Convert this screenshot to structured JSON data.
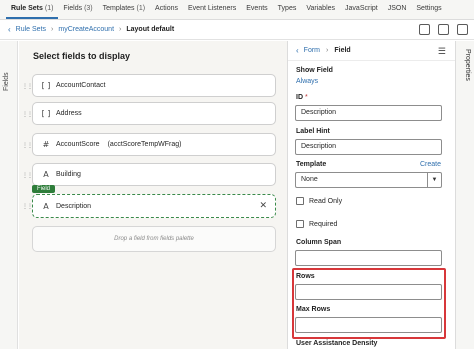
{
  "tabs": [
    {
      "label": "Rule Sets",
      "count": "(1)",
      "active": true
    },
    {
      "label": "Fields",
      "count": "(3)",
      "active": false
    },
    {
      "label": "Templates",
      "count": "(1)",
      "active": false
    },
    {
      "label": "Actions",
      "count": "",
      "active": false
    },
    {
      "label": "Event Listeners",
      "count": "",
      "active": false
    },
    {
      "label": "Events",
      "count": "",
      "active": false
    },
    {
      "label": "Types",
      "count": "",
      "active": false
    },
    {
      "label": "Variables",
      "count": "",
      "active": false
    },
    {
      "label": "JavaScript",
      "count": "",
      "active": false
    },
    {
      "label": "JSON",
      "count": "",
      "active": false
    },
    {
      "label": "Settings",
      "count": "",
      "active": false
    }
  ],
  "breadcrumb": {
    "back_icon": "chevron-left-icon",
    "items": [
      "Rule Sets",
      "myCreateAccount",
      "Layout default"
    ]
  },
  "left_rail": {
    "label": "Fields"
  },
  "right_rail": {
    "label": "Properties"
  },
  "canvas": {
    "title": "Select fields to display",
    "fields": [
      {
        "icon": "[ ]",
        "icon_name": "bracket-field-icon",
        "label": "AccountContact",
        "extra": ""
      },
      {
        "icon": "[ ]",
        "icon_name": "bracket-field-icon",
        "label": "Address",
        "extra": ""
      },
      {
        "icon": "#",
        "icon_name": "number-field-icon",
        "label": "AccountScore",
        "extra": "(acctScoreTempWFrag)"
      },
      {
        "icon": "A",
        "icon_name": "text-field-icon",
        "label": "Building",
        "extra": ""
      }
    ],
    "selected_badge": "Field",
    "selected_field": {
      "icon": "A",
      "icon_name": "text-field-icon",
      "label": "Description"
    },
    "dropzone_text": "Drop a field from fields palette"
  },
  "properties": {
    "nav_link": "Form",
    "nav_current": "Field",
    "show_field_label": "Show Field",
    "show_field_value": "Always",
    "id_label": "ID",
    "id_required": "*",
    "id_value": "Description",
    "label_hint_label": "Label Hint",
    "label_hint_value": "Description",
    "template_label": "Template",
    "template_create": "Create",
    "template_value": "None",
    "read_only_label": "Read Only",
    "required_label": "Required",
    "column_span_label": "Column Span",
    "column_span_value": "",
    "rows_label": "Rows",
    "rows_value": "",
    "max_rows_label": "Max Rows",
    "max_rows_value": "",
    "user_assist_label": "User Assistance Density"
  },
  "colors": {
    "accent": "#2f6fad",
    "selected_border": "#3a8a4a",
    "highlight": "#d7373a"
  }
}
